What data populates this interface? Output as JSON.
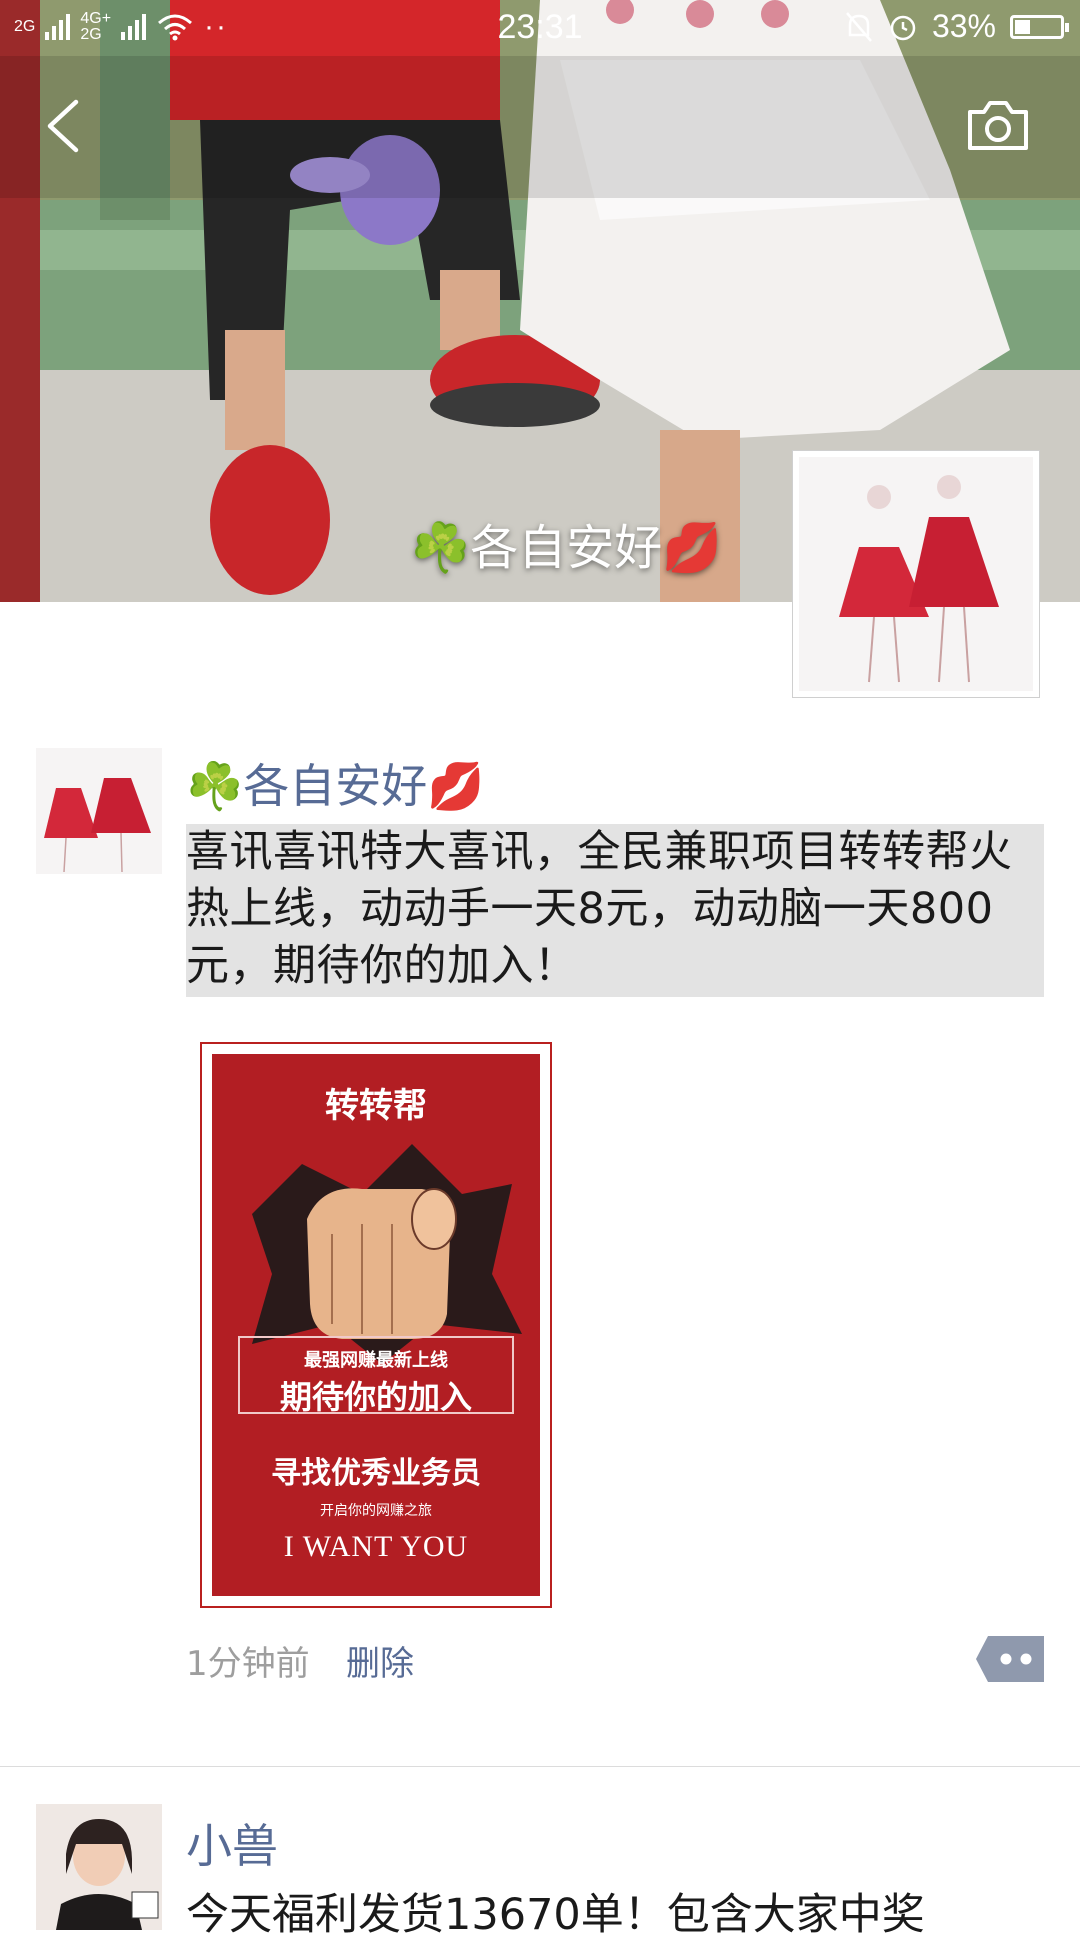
{
  "status_bar": {
    "net1": "2G",
    "net2": "4G+",
    "net3": "2G",
    "time": "23:31",
    "battery": "33%",
    "battery_level": 0.33
  },
  "cover": {
    "display_name": "☘️各自安好💋"
  },
  "post": {
    "author": "☘️各自安好💋",
    "text": "喜讯喜讯特大喜讯，全民兼职项目转转帮火热上线，动动手一天8元，动动脑一天800元，期待你的加入！",
    "poster": {
      "title": "转转帮",
      "line1": "最强网赚最新上线",
      "line2": "期待你的加入",
      "line3": "寻找优秀业务员",
      "line4": "开启你的网赚之旅",
      "line5": "I WANT YOU"
    },
    "time": "1分钟前",
    "delete_label": "删除"
  },
  "next_post": {
    "author": "小兽",
    "text": "今天福利发货13670单！包含大家中奖"
  },
  "colors": {
    "name_link": "#576b95",
    "poster_red": "#b21e23",
    "highlight_bg": "#e3e3e3"
  }
}
